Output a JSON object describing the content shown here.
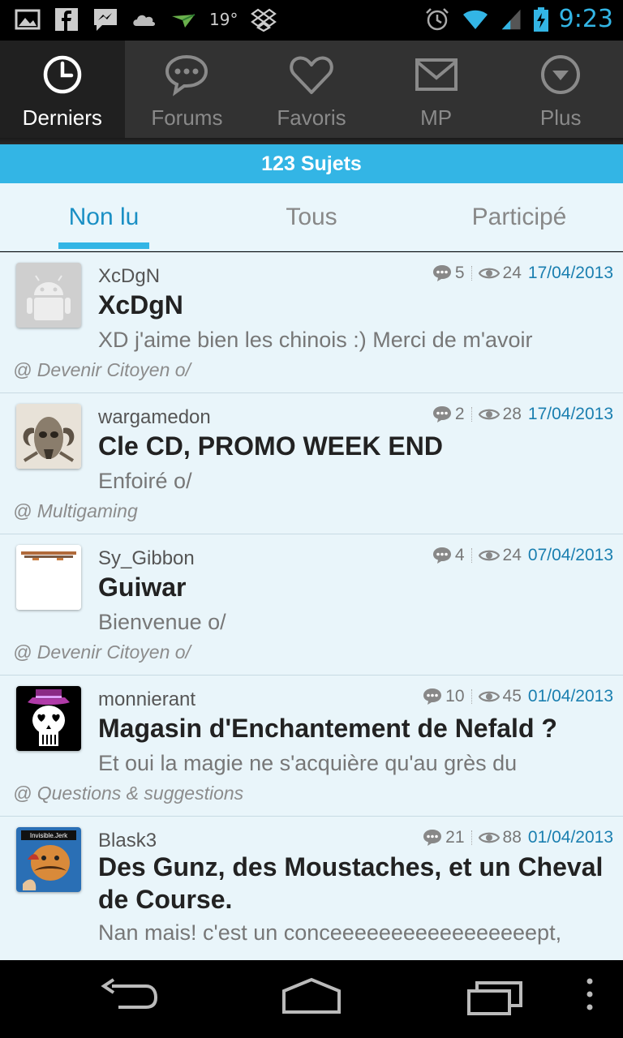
{
  "status_bar": {
    "temperature": "19°",
    "time": "9:23",
    "icons": [
      "image-icon",
      "facebook-icon",
      "messenger-icon",
      "cloud-icon",
      "plane-icon",
      "dropbox-icon",
      "alarm-icon",
      "wifi-icon",
      "signal-icon",
      "battery-icon"
    ],
    "accent_color": "#33b5e5"
  },
  "top_nav": {
    "tabs": [
      {
        "label": "Derniers",
        "icon": "clock-icon",
        "active": true
      },
      {
        "label": "Forums",
        "icon": "chat-bubble-icon",
        "active": false
      },
      {
        "label": "Favoris",
        "icon": "heart-icon",
        "active": false
      },
      {
        "label": "MP",
        "icon": "envelope-icon",
        "active": false
      },
      {
        "label": "Plus",
        "icon": "dropdown-circle-icon",
        "active": false
      }
    ]
  },
  "banner": {
    "text": "123 Sujets"
  },
  "sub_tabs": [
    {
      "label": "Non lu",
      "active": true
    },
    {
      "label": "Tous",
      "active": false
    },
    {
      "label": "Participé",
      "active": false
    }
  ],
  "topics": [
    {
      "author": "XcDgN",
      "replies": "5",
      "views": "24",
      "date": "17/04/2013",
      "title": "XcDgN",
      "excerpt": "XD j'aime bien les chinois :) Merci de m'avoir",
      "forum": "@ Devenir Citoyen o/",
      "avatar": "android-avatar"
    },
    {
      "author": "wargamedon",
      "replies": "2",
      "views": "28",
      "date": "17/04/2013",
      "title": "Cle CD, PROMO WEEK END",
      "excerpt": "Enfoiré o/",
      "forum": "@ Multigaming",
      "avatar": "ram-skull-avatar"
    },
    {
      "author": "Sy_Gibbon",
      "replies": "4",
      "views": "24",
      "date": "07/04/2013",
      "title": "Guiwar",
      "excerpt": "Bienvenue o/",
      "forum": "@ Devenir Citoyen o/",
      "avatar": "banner-avatar"
    },
    {
      "author": "monnierant",
      "replies": "10",
      "views": "45",
      "date": "01/04/2013",
      "title": "Magasin d'Enchantement de Nefald ?",
      "excerpt": "Et oui la magie ne s'acquière qu'au grès du",
      "forum": "@ Questions & suggestions",
      "avatar": "skull-hat-avatar"
    },
    {
      "author": "Blask3",
      "replies": "21",
      "views": "88",
      "date": "01/04/2013",
      "title": "Des Gunz, des Moustaches, et un Cheval de Course.",
      "excerpt": "Nan mais! c'est un conceeeeeeeeeeeeeeeeept,",
      "forum": "",
      "avatar": "mustache-avatar",
      "avatar_text": "Invisible.Jerk"
    }
  ],
  "nav_bar": {
    "buttons": [
      "back-icon",
      "home-icon",
      "recents-icon",
      "menu-icon"
    ]
  }
}
